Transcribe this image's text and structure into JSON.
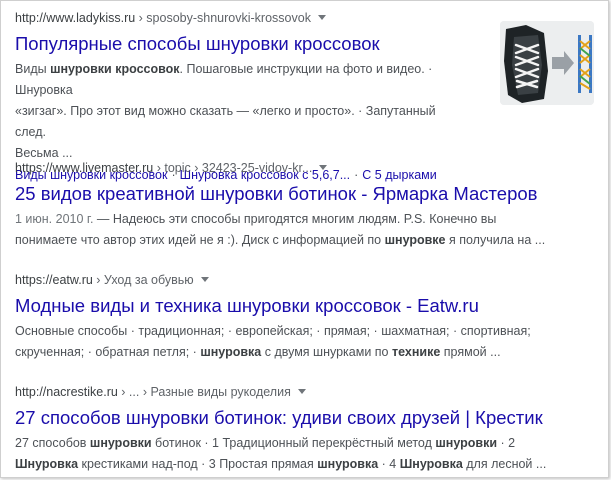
{
  "results": [
    {
      "url": "http://www.ladykiss.ru",
      "crumb": " › sposoby-shnurovki-krossovok",
      "title": "Популярные способы шнуровки кроссовок",
      "snippet": {
        "l1a": "Виды ",
        "l1b": "шнуровки кроссовок",
        "l1c": ". Пошаговые инструкции на фото и видео. · Шнуровка",
        "l2": "«зигзаг». Про этот вид можно сказать — «легко и просто». · Запутанный след.",
        "l3": "Весьма ..."
      },
      "sitelinks": [
        "Виды шнуровки кроссовок",
        "Шнуровка кроссовок с 5,6,7...",
        "С 5 дырками"
      ],
      "sitelink_sep": "·"
    },
    {
      "url": "https://www.livemaster.ru",
      "crumb": " › topic › 32423-25-vidov-kr...",
      "title": "25 видов креативной шнуровки ботинок - Ярмарка Мастеров",
      "snippet": {
        "date": "1 июн. 2010 г.",
        "l1": " — Надеюсь эти способы пригодятся многим людям. P.S. Конечно вы",
        "l2a": "понимаете что автор этих идей не я :). Диск с информацией по ",
        "l2b": "шнуровке",
        "l2c": " я получила на ..."
      }
    },
    {
      "url": "https://eatw.ru",
      "crumb": " › Уход за обувью",
      "title": "Модные виды и техника шнуровки кроссовок - Eatw.ru",
      "snippet": {
        "l1": "Основные способы · традиционная; · европейская; · прямая; · шахматная; · спортивная;",
        "l2a": "скрученная; · обратная петля; · ",
        "l2b": "шнуровка",
        "l2c": " с двумя шнурками по ",
        "l2d": "технике",
        "l2e": " прямой ..."
      }
    },
    {
      "url": "http://nacrestike.ru",
      "crumb": " › ... › Разные виды рукоделия",
      "title": "27 способов шнуровки ботинок: удиви своих друзей | Крестик",
      "snippet": {
        "l1a": "27 способов ",
        "l1b": "шнуровки",
        "l1c": " ботинок · 1 Традиционный перекрёстный метод ",
        "l1d": "шнуровки",
        "l1e": " · 2",
        "l2a": "Шнуровка",
        "l2b": " крестиками над-под · 3 Простая прямая ",
        "l2c": "шнуровка",
        "l2d": " · 4 ",
        "l2e": "Шнуровка",
        "l2f": " для лесной ..."
      }
    }
  ],
  "colors": {
    "title_link": "#1a0dab",
    "url_text": "#3c4043",
    "snippet_text": "#4d5156"
  },
  "icons": [
    "caret-down-icon",
    "sneaker-thumbnail"
  ]
}
